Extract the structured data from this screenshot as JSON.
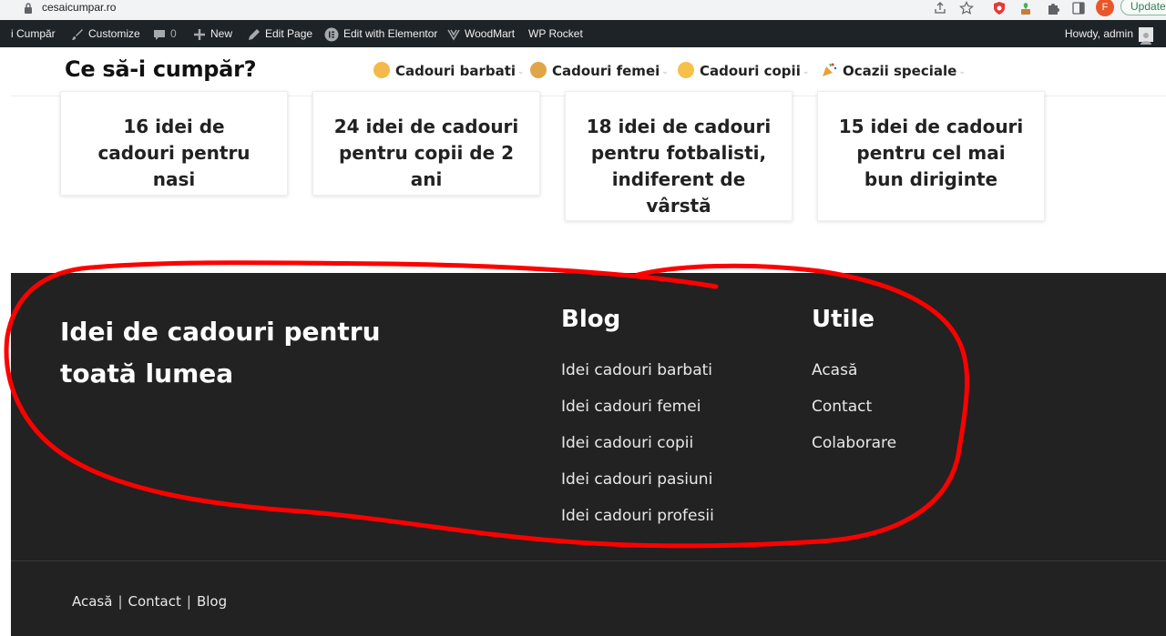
{
  "browser": {
    "url": "cesaicumpar.ro",
    "update_label": "Update",
    "profile_initial": "F"
  },
  "admin_bar": {
    "site_name": "i Cumpăr",
    "customize": "Customize",
    "comments_count": "0",
    "new": "New",
    "edit_page": "Edit Page",
    "edit_elementor": "Edit with Elementor",
    "woodmart": "WoodMart",
    "wp_rocket": "WP Rocket",
    "howdy": "Howdy, admin"
  },
  "header": {
    "logo": "Ce să-i cumpăr?",
    "nav": [
      {
        "label": "Cadouri barbati"
      },
      {
        "label": "Cadouri femei"
      },
      {
        "label": "Cadouri copii"
      },
      {
        "label": "Ocazii speciale"
      }
    ]
  },
  "cards": [
    {
      "title": "16 idei de cadouri pentru nasi"
    },
    {
      "title": "24 idei de cadouri pentru copii de 2 ani"
    },
    {
      "title": "18 idei de cadouri pentru fotbalisti, indiferent de vârstă"
    },
    {
      "title": "15 idei de cadouri pentru cel mai bun diriginte"
    }
  ],
  "footer": {
    "tagline": "Idei de cadouri pentru toată lumea",
    "blog": {
      "title": "Blog",
      "links": [
        "Idei cadouri barbati",
        "Idei cadouri femei",
        "Idei cadouri copii",
        "Idei cadouri pasiuni",
        "Idei cadouri profesii"
      ]
    },
    "utile": {
      "title": "Utile",
      "links": [
        "Acasă",
        "Contact",
        "Colaborare"
      ]
    },
    "bottom_links": [
      "Acasă",
      "Contact",
      "Blog"
    ]
  },
  "colors": {
    "footer_bg": "#222222",
    "admin_bar_bg": "#1d2327",
    "annotation": "#ff0000"
  }
}
